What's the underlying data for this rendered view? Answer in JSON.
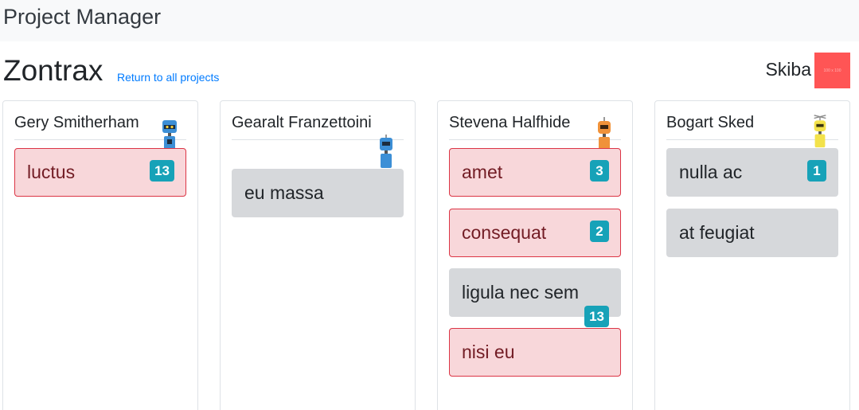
{
  "navbar": {
    "brand": "Project Manager"
  },
  "project": {
    "title": "Zontrax",
    "return_link": "Return to all projects"
  },
  "owner": {
    "name": "Skiba",
    "avatar_text": "100 x 100"
  },
  "columns": [
    {
      "member": "Gery Smitherham",
      "robot_color": "#3c8fd6",
      "tasks": [
        {
          "label": "luctus",
          "points": "13",
          "status": "overdue"
        }
      ]
    },
    {
      "member": "Gearalt Franzettoini",
      "robot_color": "#3c8fd6",
      "tasks": [
        {
          "label": "eu massa",
          "points": "",
          "status": "normal"
        }
      ]
    },
    {
      "member": "Stevena Halfhide",
      "robot_color": "#f0923a",
      "tasks": [
        {
          "label": "amet",
          "points": "3",
          "status": "overdue"
        },
        {
          "label": "consequat",
          "points": "2",
          "status": "overdue"
        },
        {
          "label": "ligula nec sem",
          "points": "13",
          "status": "normal"
        },
        {
          "label": "nisi eu",
          "points": "",
          "status": "overdue"
        }
      ]
    },
    {
      "member": "Bogart Sked",
      "robot_color": "#f3e24a",
      "tasks": [
        {
          "label": "nulla ac",
          "points": "1",
          "status": "normal"
        },
        {
          "label": "at feugiat",
          "points": "",
          "status": "normal"
        }
      ]
    }
  ],
  "colors": {
    "overdue_bg": "#f8d7da",
    "normal_bg": "#d6d8db",
    "badge": "#17a2b8",
    "link": "#007bff"
  }
}
